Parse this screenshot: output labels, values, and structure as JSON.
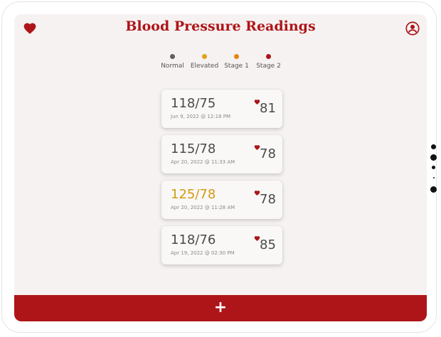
{
  "app": {
    "title": "Blood Pressure Readings",
    "accent_color": "#ad1519"
  },
  "header": {
    "logo_icon": "heart-icon",
    "profile_icon": "user-circle-icon"
  },
  "legend": [
    {
      "label": "Normal",
      "color": "#5e5e5e"
    },
    {
      "label": "Elevated",
      "color": "#e2a21a"
    },
    {
      "label": "Stage 1",
      "color": "#e58417"
    },
    {
      "label": "Stage 2",
      "color": "#ad1519"
    }
  ],
  "readings": [
    {
      "bp": "118/75",
      "date": "Jun 9, 2022 @ 12:18 PM",
      "pulse": "81",
      "category": "normal"
    },
    {
      "bp": "115/78",
      "date": "Apr 20, 2022 @ 11:33 AM",
      "pulse": "78",
      "category": "normal"
    },
    {
      "bp": "125/78",
      "date": "Apr 20, 2022 @ 11:28 AM",
      "pulse": "78",
      "category": "elevated"
    },
    {
      "bp": "118/76",
      "date": "Apr 19, 2022 @ 02:30 PM",
      "pulse": "85",
      "category": "normal"
    }
  ],
  "footer": {
    "add_label": "+"
  }
}
